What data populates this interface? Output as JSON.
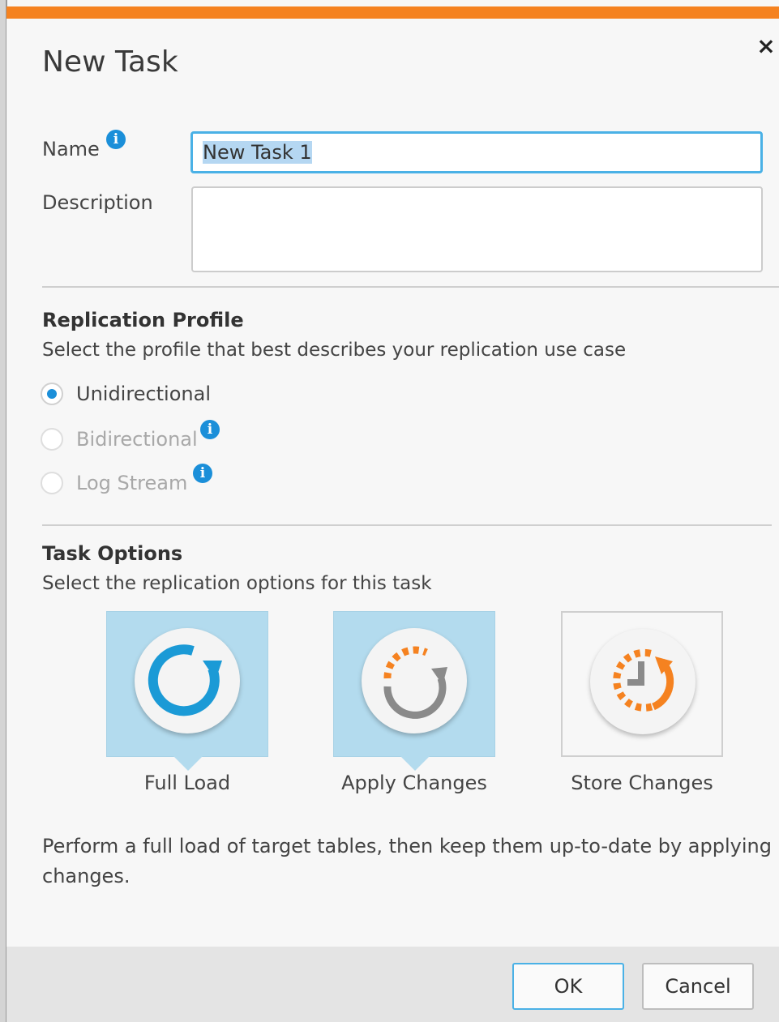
{
  "dialog": {
    "title": "New Task",
    "close_glyph": "×",
    "accent_color": "#f58220"
  },
  "form": {
    "name_label": "Name",
    "name_value": "New Task 1",
    "description_label": "Description",
    "description_value": "",
    "info_glyph": "i"
  },
  "replication_profile": {
    "title": "Replication Profile",
    "subtitle": "Select the profile that best describes your replication use case",
    "options": [
      {
        "label": "Unidirectional",
        "checked": true,
        "enabled": true
      },
      {
        "label": "Bidirectional",
        "checked": false,
        "enabled": false,
        "has_info": true
      },
      {
        "label": "Log Stream",
        "checked": false,
        "enabled": false,
        "has_info": true
      }
    ]
  },
  "task_options": {
    "title": "Task Options",
    "subtitle": "Select the replication options for this task",
    "tiles": [
      {
        "label": "Full Load",
        "selected": true,
        "icon": "full-load-icon"
      },
      {
        "label": "Apply Changes",
        "selected": true,
        "icon": "apply-changes-icon"
      },
      {
        "label": "Store Changes",
        "selected": false,
        "icon": "store-changes-icon"
      }
    ],
    "summary": "Perform a full load of target tables, then keep them up-to-date by applying changes."
  },
  "footer": {
    "ok_label": "OK",
    "cancel_label": "Cancel"
  },
  "colors": {
    "selected_tile": "#b3dbee",
    "info_blue": "#1b8fd9",
    "focus_blue": "#4ab1e6",
    "icon_orange": "#f58220",
    "icon_gray": "#8a8a8a"
  }
}
